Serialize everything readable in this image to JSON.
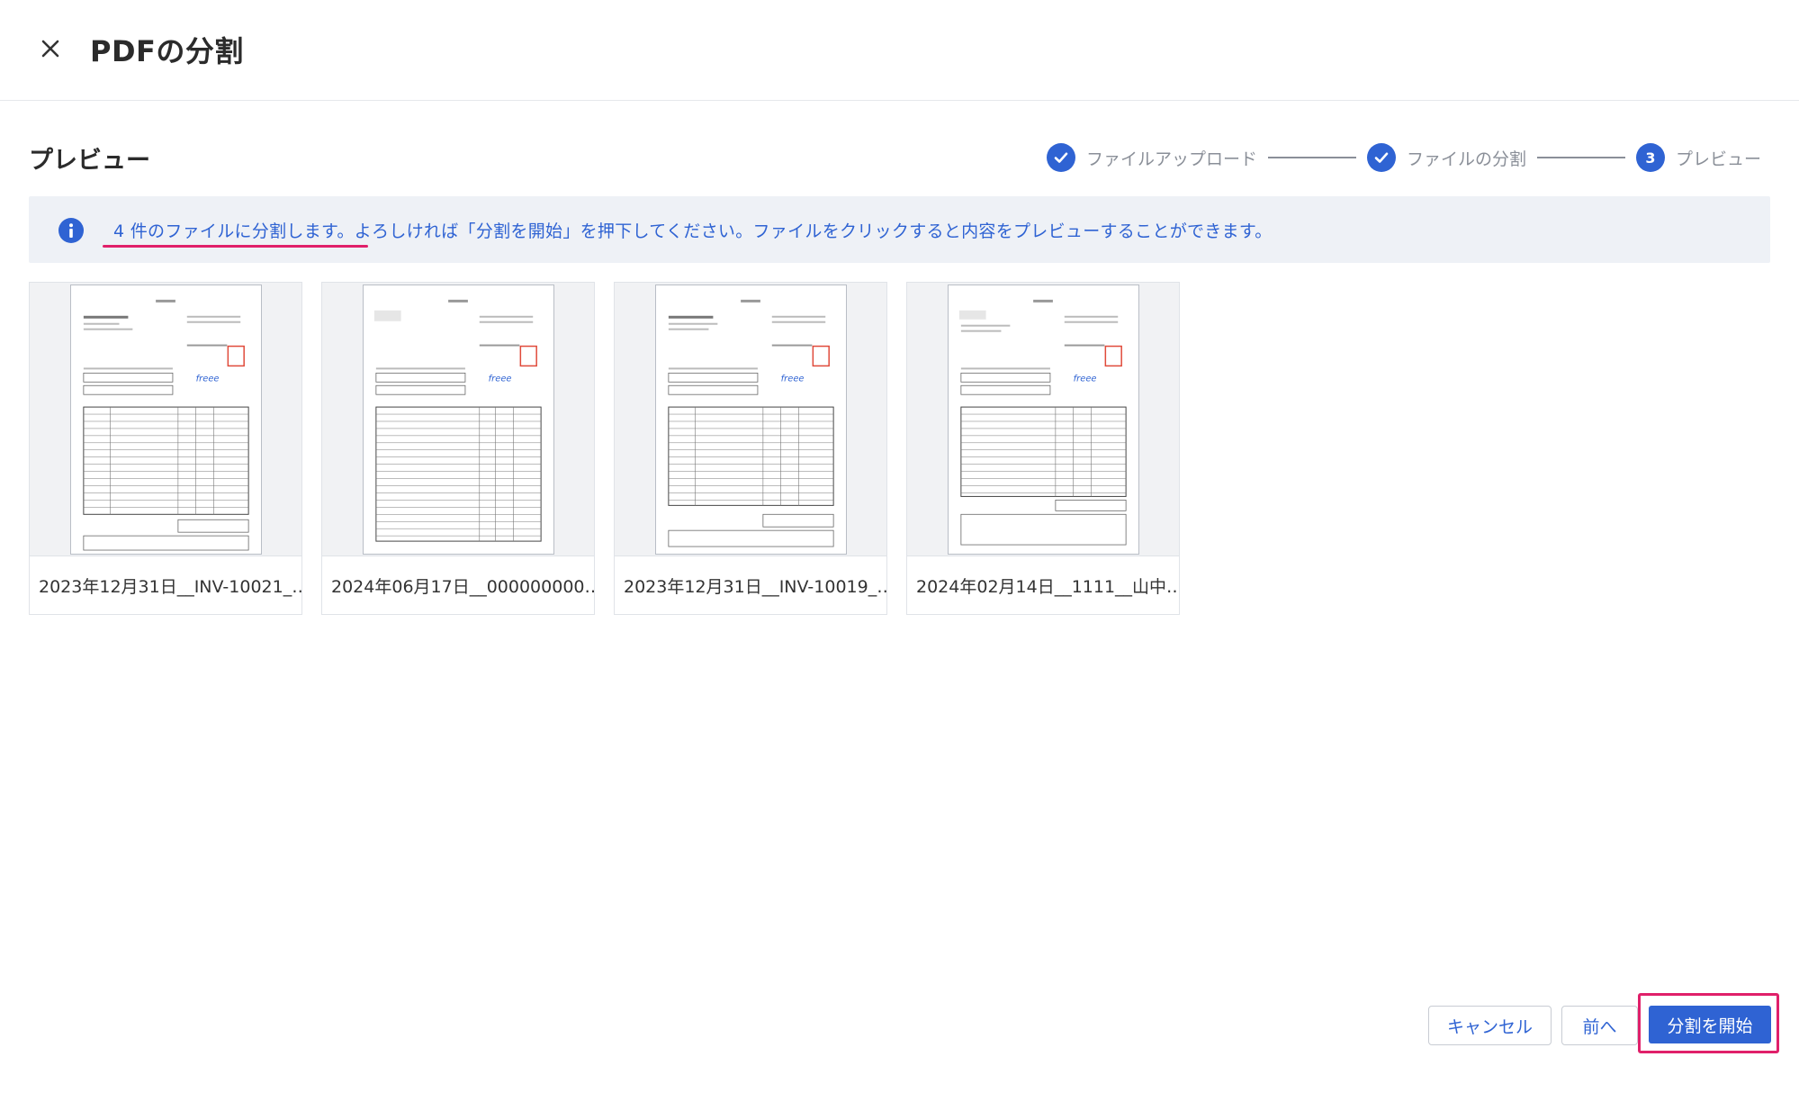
{
  "header": {
    "title": "PDFの分割",
    "close_icon": "close-icon"
  },
  "section": {
    "title": "プレビュー"
  },
  "stepper": {
    "steps": [
      {
        "label": "ファイルアップロード",
        "state": "done"
      },
      {
        "label": "ファイルの分割",
        "state": "done"
      },
      {
        "label": "プレビュー",
        "state": "current",
        "number": "3"
      }
    ]
  },
  "info": {
    "text": "4 件のファイルに分割します。よろしければ「分割を開始」を押下してください。ファイルをクリックすると内容をプレビューすることができます。",
    "icon": "info-icon"
  },
  "files": [
    {
      "name": "2023年12月31日__INV-10021_…"
    },
    {
      "name": "2024年06月17日__000000000…"
    },
    {
      "name": "2023年12月31日__INV-10019_…"
    },
    {
      "name": "2024年02月14日__1111__山中…"
    }
  ],
  "footer": {
    "cancel_label": "キャンセル",
    "prev_label": "前へ",
    "start_label": "分割を開始"
  },
  "colors": {
    "accent": "#2f63d3",
    "highlight": "#e0206a",
    "banner_bg": "#eef1f6"
  }
}
